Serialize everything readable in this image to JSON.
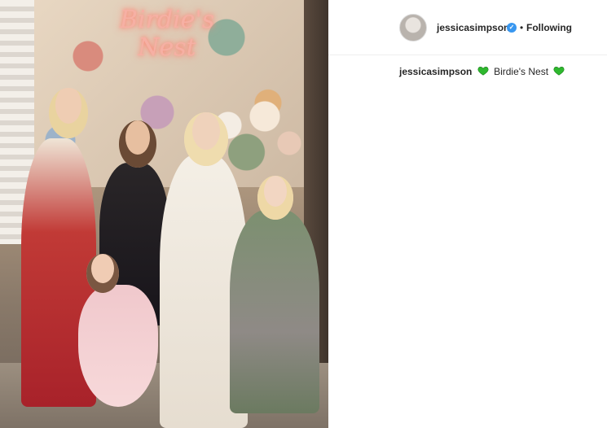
{
  "post": {
    "image_alt": "Group photo",
    "neon_sign": [
      "Birdie's",
      "Nest"
    ]
  },
  "header": {
    "username": "jessicasimpson",
    "verified_icon": "verified-badge-icon",
    "separator": "•",
    "follow_label": "Following"
  },
  "caption": {
    "username": "jessicasimpson",
    "text": "Birdie's Nest",
    "icon": "green-heart-icon",
    "icon_color": "#2eb82e"
  }
}
